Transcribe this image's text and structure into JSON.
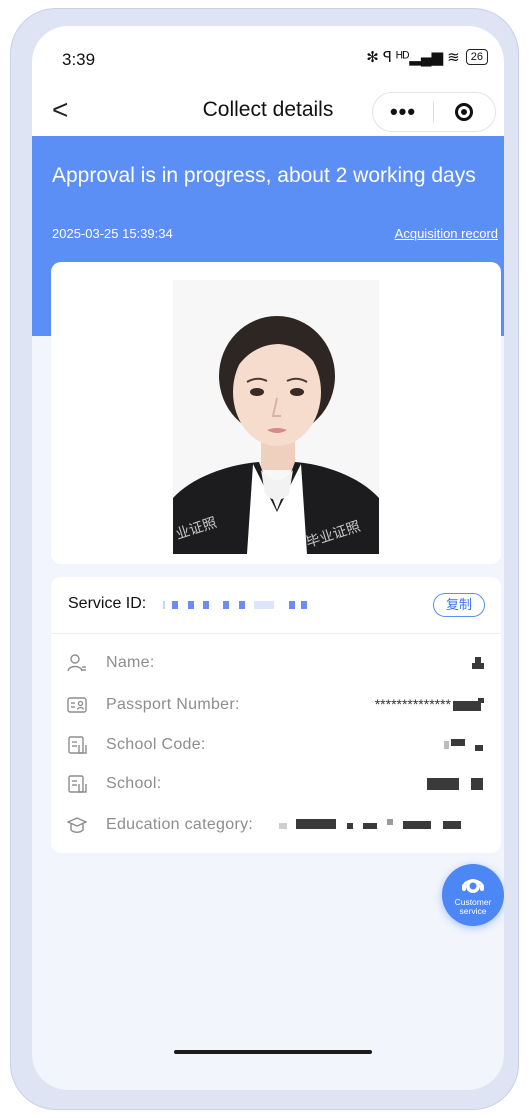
{
  "status": {
    "time": "3:39",
    "icons": "✻ ꟼ ᴴᴰ▂▄▆ ≋",
    "battery": "26"
  },
  "nav": {
    "back_icon": "chevron-left-icon",
    "back_glyph": "<",
    "title": "Collect details",
    "more_glyph": "•••"
  },
  "banner": {
    "title": "Approval is in progress, about 2 working days",
    "datetime": "2025-03-25 15:39:34",
    "link": "Acquisition record",
    "color": "#5b8ff5"
  },
  "photo": {
    "watermark_left": "业证照",
    "watermark_right": "毕业证照"
  },
  "info": {
    "service_id_label": "Service ID:",
    "copy_label": "复制",
    "rows": [
      {
        "label": "Name:",
        "icon": "person-icon",
        "value": ""
      },
      {
        "label": "Passport Number:",
        "icon": "id-card-icon",
        "value": "**************"
      },
      {
        "label": "School Code:",
        "icon": "document-icon",
        "value": ""
      },
      {
        "label": "School:",
        "icon": "document-icon",
        "value": ""
      },
      {
        "label": "Education category:",
        "icon": "graduation-cap-icon",
        "value": ""
      }
    ]
  },
  "customer_service": {
    "label_line1": "Customer",
    "label_line2": "service"
  }
}
